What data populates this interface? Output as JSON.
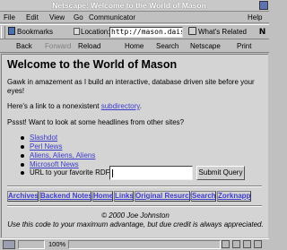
{
  "window": {
    "title": "Netscape: Welcome to the World of Mason"
  },
  "menu": {
    "file": "File",
    "edit": "Edit",
    "view": "View",
    "go": "Go",
    "communicator": "Communicator",
    "help": "Help"
  },
  "location_toolbar": {
    "bookmarks": "Bookmarks",
    "location_label": "Location:",
    "url": "http://mason.dais",
    "whats_related": "What's Related",
    "n_logo": "N"
  },
  "nav_toolbar": {
    "back": "Back",
    "forward": "Forward",
    "reload": "Reload",
    "home": "Home",
    "search": "Search",
    "netscape": "Netscape",
    "print": "Print"
  },
  "page": {
    "heading": "Welcome to the World of Mason",
    "intro_line1": "Gawk in amazement as I build an interactive, database driven site before your",
    "intro_line2": "eyes!",
    "link_sentence_before": "Here's a link to a nonexistent ",
    "link_sentence_link": "subdirectory",
    "link_sentence_after": ".",
    "headlines_prompt": "Pssst! Want to look at some headlines from other sites?",
    "headline_links": [
      "Slashdot",
      "Perl News",
      "Aliens, Aliens, Aliens",
      "Microsoft News"
    ],
    "rdf_label": "URL to your favorite RDF:",
    "rdf_value": "",
    "submit_label": "Submit Query",
    "nav_links": [
      "Archives",
      "Backend Notes",
      "Home",
      "Links",
      "Original Resurch",
      "Search",
      "Zorknapp"
    ],
    "copyright": "© 2000 Joe Johnston",
    "license": "Use this code to your maximum advantage, but due credit is always appreciated."
  },
  "status": {
    "percent": "100%"
  }
}
